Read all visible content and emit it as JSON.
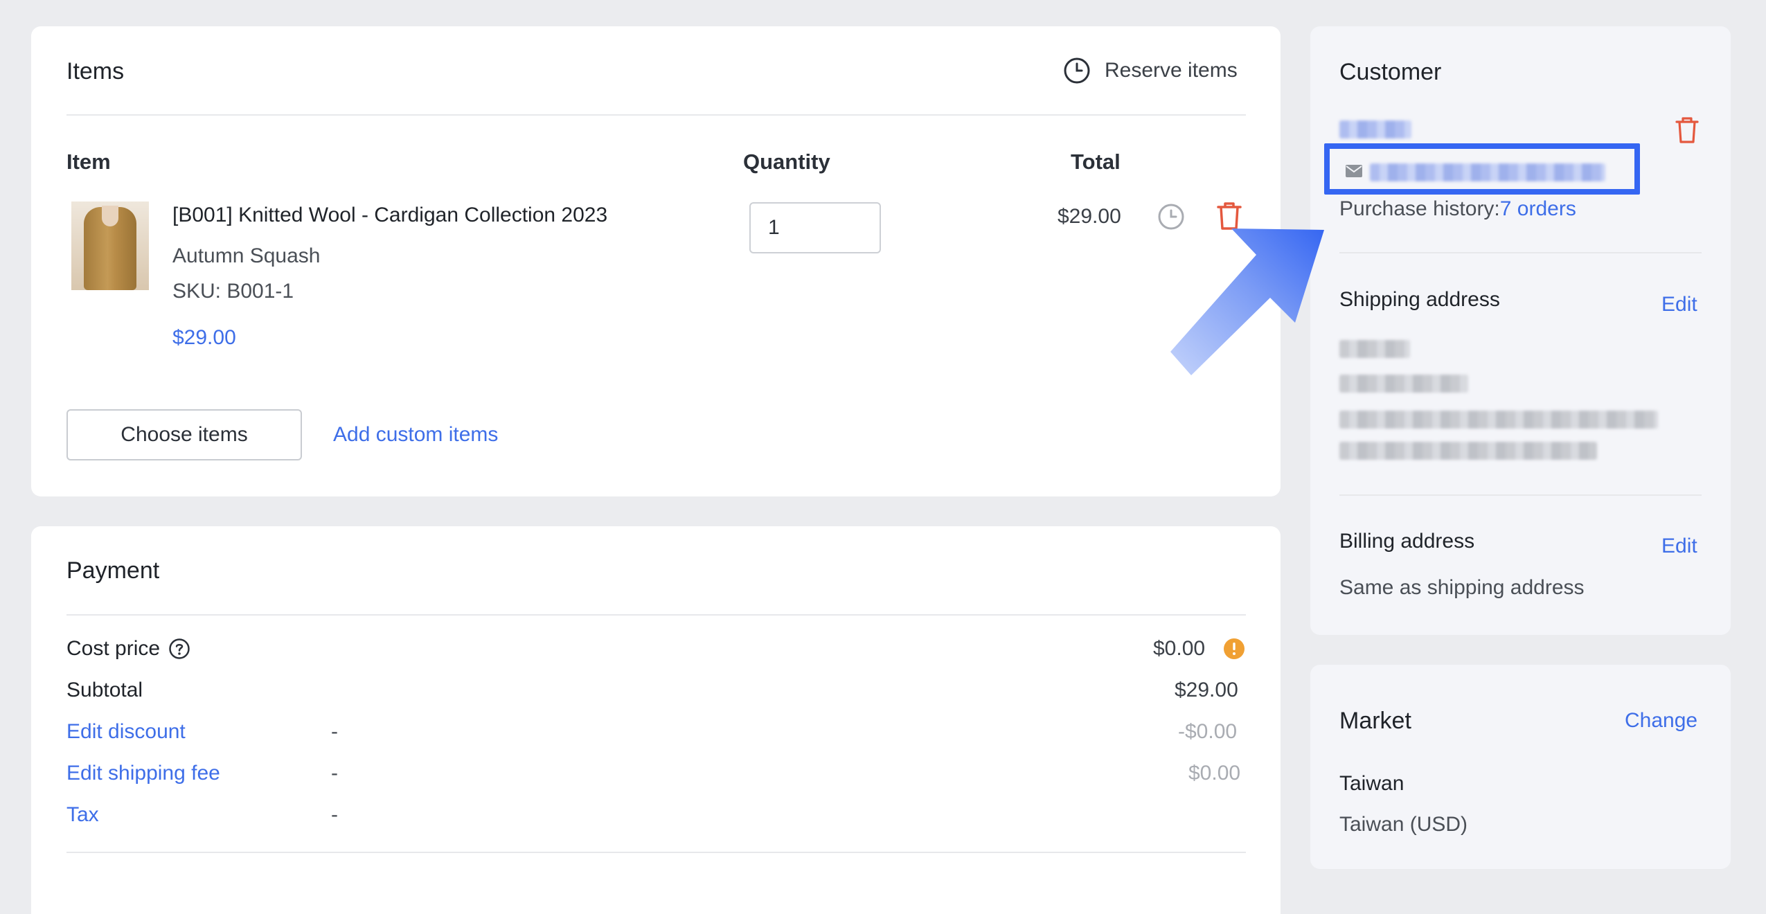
{
  "items": {
    "title": "Items",
    "reserve_label": "Reserve items",
    "columns": {
      "item": "Item",
      "quantity": "Quantity",
      "total": "Total"
    },
    "line": {
      "name": "[B001] Knitted Wool - Cardigan Collection 2023",
      "variant": "Autumn Squash",
      "sku": "SKU: B001-1",
      "price": "$29.00",
      "quantity": "1",
      "total": "$29.00"
    },
    "choose_label": "Choose items",
    "add_custom_label": "Add custom items"
  },
  "payment": {
    "title": "Payment",
    "rows": [
      {
        "label": "Cost price",
        "mid": "",
        "value": "$0.00"
      },
      {
        "label": "Subtotal",
        "mid": "",
        "value": "$29.00"
      },
      {
        "label": "Edit discount",
        "mid": "-",
        "value": "-$0.00"
      },
      {
        "label": "Edit shipping fee",
        "mid": "-",
        "value": "$0.00"
      },
      {
        "label": "Tax",
        "mid": "-",
        "value": ""
      }
    ]
  },
  "customer": {
    "title": "Customer",
    "purchase_history_label": "Purchase history:",
    "purchase_history_link": "7 orders",
    "shipping_title": "Shipping address",
    "shipping_edit": "Edit",
    "billing_title": "Billing address",
    "billing_edit": "Edit",
    "billing_value": "Same as shipping address"
  },
  "market": {
    "title": "Market",
    "change_label": "Change",
    "name": "Taiwan",
    "currency": "Taiwan (USD)"
  },
  "colors": {
    "link": "#3e6ee8",
    "danger": "#e4583e",
    "warning": "#f0a033",
    "highlight": "#3566f2"
  }
}
